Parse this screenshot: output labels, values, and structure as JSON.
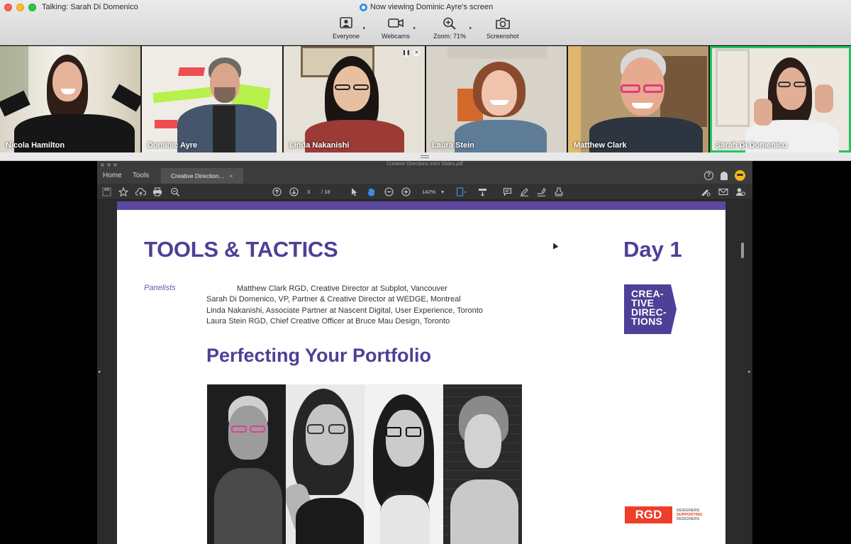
{
  "zoom_window": {
    "talking": "Talking: Sarah Di Domenico",
    "viewing": "Now viewing Dominic Ayre's screen",
    "toolbar": {
      "everyone": "Everyone",
      "webcams": "Webcams",
      "zoom": "Zoom: 71%",
      "screenshot": "Screenshot"
    },
    "participants": [
      {
        "name": "Nicola Hamilton"
      },
      {
        "name": "Dominic Ayre"
      },
      {
        "name": "Linda Nakanishi"
      },
      {
        "name": "Laura Stein"
      },
      {
        "name": "Matthew Clark"
      },
      {
        "name": "Sarah Di Domenico",
        "active": true
      }
    ],
    "active_speaker_color": "#22c55e"
  },
  "acrobat": {
    "file_title": "Creative Directions Intro Slides.pdf",
    "tabs": {
      "home": "Home",
      "tools": "Tools",
      "doc": "Creative Direction...",
      "close": "×"
    },
    "help": "?",
    "page_current": "3",
    "page_total": "/ 18",
    "zoom": "142%"
  },
  "slide": {
    "title": "TOOLS & TACTICS",
    "day": "Day 1",
    "panelists_label": "Panelists",
    "panelists": [
      "Matthew Clark RGD, Creative Director at Subplot, Vancouver",
      "Sarah Di Domenico, VP, Partner & Creative Director at WEDGE, Montreal",
      "Linda Nakanishi, Associate Partner at Nascent Digital, User Experience, Toronto",
      "Laura Stein RGD, Chief Creative Officer at Bruce Mau Design, Toronto"
    ],
    "subtitle": "Perfecting Your Portfolio",
    "logo_lines": [
      "CREA-",
      "TIVE",
      "DIREC-",
      "TIONS"
    ],
    "rgd_logo": "RGD",
    "rgd_tagline": [
      "DESIGNERS",
      "SUPPORTING",
      "DESIGNERS"
    ],
    "brand_color": "#4f3f97",
    "accent_bar_color": "#5d48a0"
  }
}
